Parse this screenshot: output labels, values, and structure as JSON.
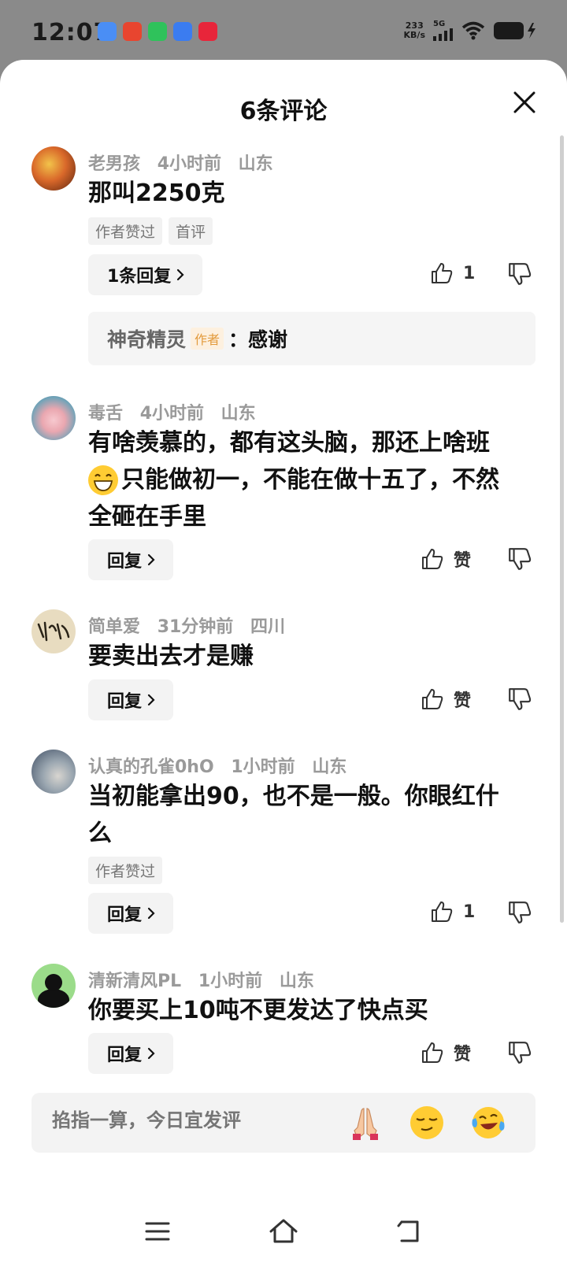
{
  "status_bar": {
    "time": "12:07",
    "net_speed_value": "233",
    "net_speed_unit": "KB/s",
    "network": "5G"
  },
  "sheet": {
    "title": "6条评论"
  },
  "comments": [
    {
      "user": "老男孩",
      "time": "4小时前",
      "location": "山东",
      "text": "那叫2250克",
      "tags": [
        "作者赞过",
        "首评"
      ],
      "reply_label": "1条回复",
      "like_count": "1",
      "sub_reply": {
        "user": "神奇精灵",
        "author_tag": "作者",
        "text": "：感谢"
      }
    },
    {
      "user": "毒舌",
      "time": "4小时前",
      "location": "山东",
      "text_line1": "有啥羡慕的，都有这头脑，那还上啥班",
      "text_line2": "只能做初一，不能在做十五了，不然",
      "text_line3": "全砸在手里",
      "reply_label": "回复",
      "like_count": "赞"
    },
    {
      "user": "简单爱",
      "time": "31分钟前",
      "location": "四川",
      "text": "要卖出去才是赚",
      "reply_label": "回复",
      "like_count": "赞"
    },
    {
      "user": "认真的孔雀0hO",
      "time": "1小时前",
      "location": "山东",
      "text_line1": "当初能拿出90，也不是一般。你眼红什",
      "text_line2": "么",
      "tags": [
        "作者赞过"
      ],
      "reply_label": "回复",
      "like_count": "1"
    },
    {
      "user": "清新清风PL",
      "time": "1小时前",
      "location": "山东",
      "text": "你要买上10吨不更发达了快点买",
      "reply_label": "回复",
      "like_count": "赞"
    }
  ],
  "input": {
    "placeholder": "掐指一算，今日宜发评"
  },
  "icons": {
    "like": "thumbs-up-icon",
    "dislike": "thumbs-down-icon",
    "close": "close-icon",
    "emoji_1": "praying-hands-emoji",
    "emoji_2": "smirk-emoji",
    "emoji_3": "laughing-crying-emoji",
    "nav_menu": "menu-icon",
    "nav_home": "home-icon",
    "nav_back": "back-icon"
  }
}
